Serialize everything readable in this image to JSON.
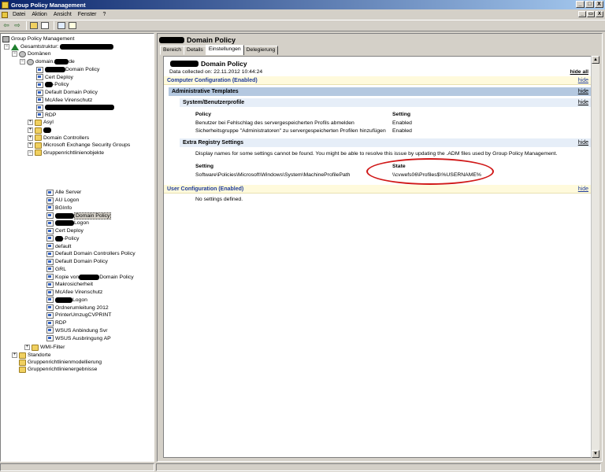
{
  "window": {
    "title": "Group Policy Management"
  },
  "menu": {
    "items": [
      "Datei",
      "Aktion",
      "Ansicht",
      "Fenster",
      "?"
    ]
  },
  "window_buttons": {
    "min": "_",
    "max": "□",
    "close": "X"
  },
  "mdi_buttons": {
    "min": "_",
    "restore": "▭",
    "close": "X"
  },
  "tree": {
    "root": "Group Policy Management",
    "forest": "Gesamtstruktur:",
    "domains": "Domänen",
    "domain": "domain.",
    "domain_suffix": "de",
    "items_top": [
      "Domain Policy",
      "Cert Deploy",
      "-Policy",
      "Default Domain Policy",
      "McAfee Virenschutz",
      "",
      "RDP",
      "Asyl",
      "",
      "Domain Controllers",
      "Microsoft Exchange Security Groups",
      "Gruppenrichtlinienobjekte"
    ],
    "gpo_objects": [
      "Alle Server",
      "AU Logon",
      "BGInfo",
      "Domain Policy",
      "Logon",
      "Cert Deploy",
      "-Policy",
      "default",
      "Default Domain Controllers Policy",
      "Default Domain Policy",
      "GRL",
      "Domain Policy",
      "Makrosicherheit",
      "McAfee Virenschutz",
      "Logon",
      "Ordnerumleitung 2012",
      "PrinterUmzugCVPRINT",
      "RDP",
      "WSUS Anbindung Svr",
      "WSUS Ausbringung AP"
    ],
    "kopie_prefix": "Kopie von ",
    "wmi": "WMI-Filter",
    "standorte": "Standorte",
    "modellierung": "Gruppenrichtlinienmodellierung",
    "ergebnisse": "Gruppenrichtlinienergebnisse"
  },
  "main": {
    "header_title": "Domain Policy",
    "tabs": [
      "Bereich",
      "Details",
      "Einstellungen",
      "Delegierung"
    ],
    "active_tab": "Einstellungen",
    "report": {
      "title": "Domain Policy",
      "collected": "Data collected on: 22.11.2012 10:44:24",
      "hide_all": "hide all",
      "hide": "hide",
      "computer_config": "Computer Configuration (Enabled)",
      "admin_templates": "Administrative Templates",
      "system_profiles": "System/Benutzerprofile",
      "policy_header": "Policy",
      "setting_header": "Setting",
      "policies": [
        {
          "name": "Benutzer bei Fehlschlag des servergespeicherten Profils abmelden",
          "setting": "Enabled"
        },
        {
          "name": "Sicherheitsgruppe \"Administratoren\" zu servergespeicherten Profilen hinzufügen",
          "setting": "Enabled"
        }
      ],
      "extra_registry": "Extra Registry Settings",
      "extra_note": "Display names for some settings cannot be found. You might be able to resolve this issue by updating the .ADM files used by Group Policy Management.",
      "reg_setting_header": "Setting",
      "reg_state_header": "State",
      "reg_setting": "Software\\Policies\\Microsoft\\Windows\\System\\MachineProfilePath",
      "reg_state": "\\\\cvwefs06\\Profiles$\\%USERNAME%",
      "user_config": "User Configuration (Enabled)",
      "no_settings": "No settings defined."
    }
  },
  "colors": {
    "titlebar": "#0a246a",
    "band_yellow": "#fffadc",
    "band_blue": "#b4c8e0",
    "annotation_ellipse": "#d01818"
  },
  "icons": [
    "back-arrow-icon",
    "forward-arrow-icon",
    "up-folder-icon",
    "console-tree-icon",
    "properties-icon",
    "help-icon"
  ]
}
